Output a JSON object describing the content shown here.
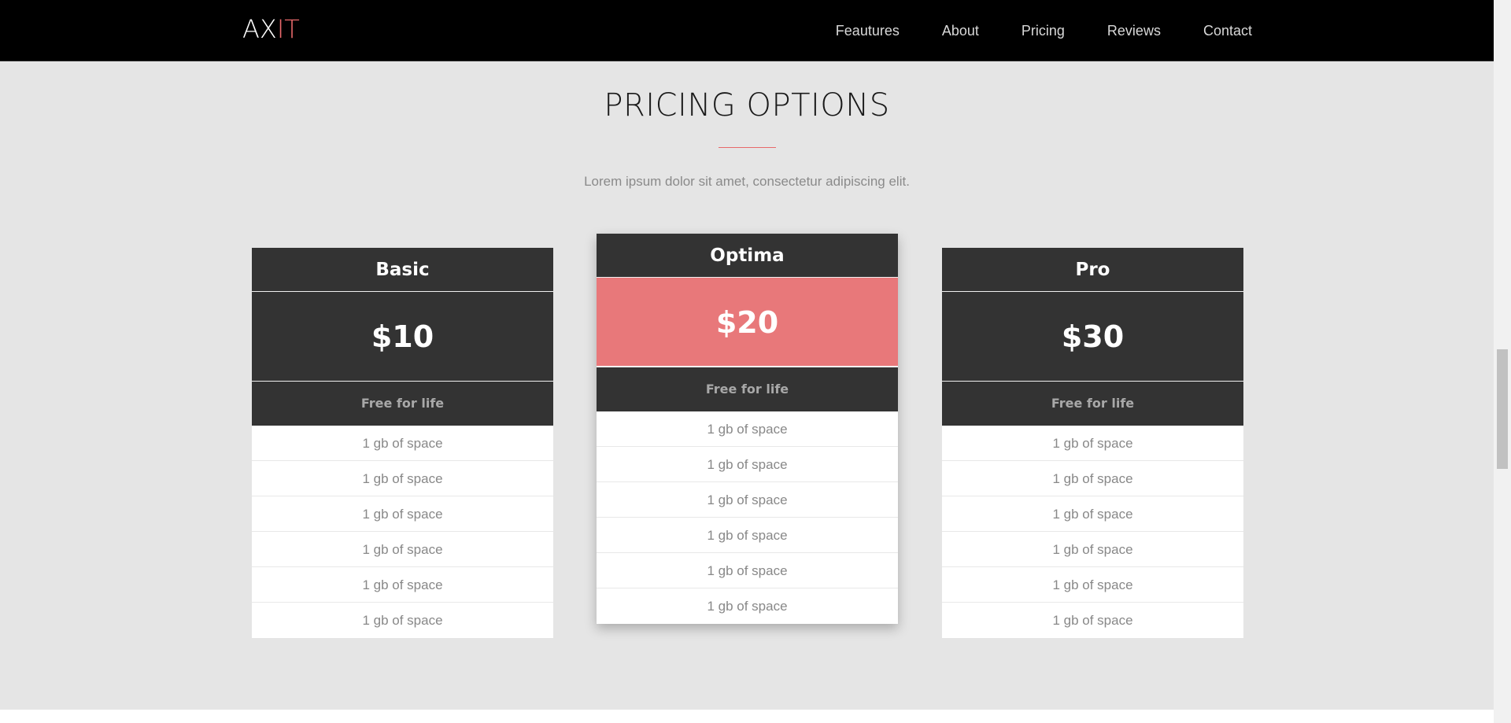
{
  "brand": {
    "part_a": "AX",
    "part_b": "IT",
    "accent_color": "#e8696b"
  },
  "nav": {
    "items": [
      {
        "label": "Feautures"
      },
      {
        "label": "About"
      },
      {
        "label": "Pricing"
      },
      {
        "label": "Reviews"
      },
      {
        "label": "Contact"
      }
    ]
  },
  "section": {
    "title": "PRICING OPTIONS",
    "subtitle": "Lorem ipsum dolor sit amet, consectetur adipiscing elit.",
    "background_color": "#e5e5e5"
  },
  "plans": [
    {
      "name": "Basic",
      "price": "$10",
      "tagline": "Free for life",
      "features": [
        "1 gb of space",
        "1 gb of space",
        "1 gb of space",
        "1 gb of space",
        "1 gb of space",
        "1 gb of space"
      ]
    },
    {
      "name": "Optima",
      "price": "$20",
      "tagline": "Free for life",
      "featured": true,
      "features": [
        "1 gb of space",
        "1 gb of space",
        "1 gb of space",
        "1 gb of space",
        "1 gb of space",
        "1 gb of space"
      ]
    },
    {
      "name": "Pro",
      "price": "$30",
      "tagline": "Free for life",
      "features": [
        "1 gb of space",
        "1 gb of space",
        "1 gb of space",
        "1 gb of space",
        "1 gb of space",
        "1 gb of space"
      ]
    }
  ],
  "colors": {
    "card_dark": "#333333",
    "featured_price": "#e8787a",
    "navbar": "#000000"
  }
}
